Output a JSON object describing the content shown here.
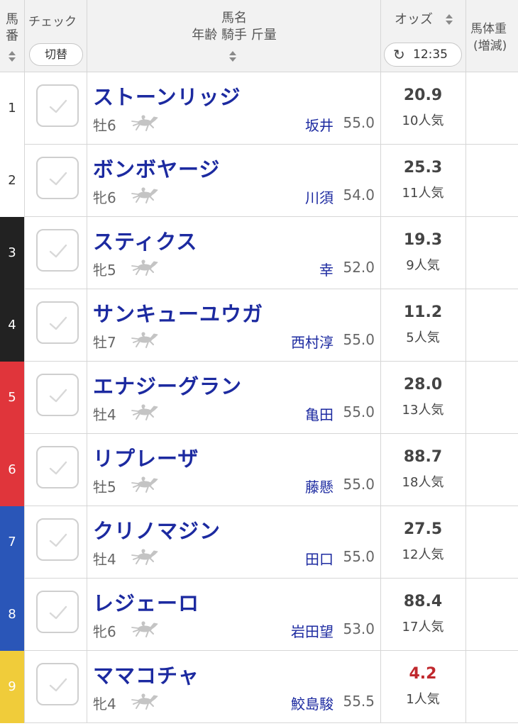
{
  "header": {
    "num_line1": "馬",
    "num_line2": "番",
    "check_label": "チェック",
    "toggle_label": "切替",
    "name_label": "馬名",
    "sub_label": "年齢 騎手 斤量",
    "odds_label": "オッズ",
    "refresh_icon": "refresh-icon",
    "refresh_time": "12:35",
    "weight_line1": "馬体重",
    "weight_line2": "(増減)"
  },
  "colors": {
    "name_blue": "#1c2aa0",
    "favorite_red": "#c0282d"
  },
  "horses": [
    {
      "num": "1",
      "name": "ストーンリッジ",
      "sex_age": "牡6",
      "jockey": "坂井",
      "weight": "55.0",
      "odds": "20.9",
      "popularity": "10人気",
      "frame_color": "#ffffff",
      "num_color": "#333333",
      "favorite": false
    },
    {
      "num": "2",
      "name": "ボンボヤージ",
      "sex_age": "牝6",
      "jockey": "川須",
      "weight": "54.0",
      "odds": "25.3",
      "popularity": "11人気",
      "frame_color": "#ffffff",
      "num_color": "#333333",
      "favorite": false
    },
    {
      "num": "3",
      "name": "スティクス",
      "sex_age": "牝5",
      "jockey": "幸",
      "weight": "52.0",
      "odds": "19.3",
      "popularity": "9人気",
      "frame_color": "#222222",
      "num_color": "#ffffff",
      "favorite": false
    },
    {
      "num": "4",
      "name": "サンキューユウガ",
      "sex_age": "牡7",
      "jockey": "西村淳",
      "weight": "55.0",
      "odds": "11.2",
      "popularity": "5人気",
      "frame_color": "#222222",
      "num_color": "#ffffff",
      "favorite": false
    },
    {
      "num": "5",
      "name": "エナジーグラン",
      "sex_age": "牡4",
      "jockey": "亀田",
      "weight": "55.0",
      "odds": "28.0",
      "popularity": "13人気",
      "frame_color": "#e0353b",
      "num_color": "#ffffff",
      "favorite": false
    },
    {
      "num": "6",
      "name": "リプレーザ",
      "sex_age": "牡5",
      "jockey": "藤懸",
      "weight": "55.0",
      "odds": "88.7",
      "popularity": "18人気",
      "frame_color": "#e0353b",
      "num_color": "#ffffff",
      "favorite": false
    },
    {
      "num": "7",
      "name": "クリノマジン",
      "sex_age": "牡4",
      "jockey": "田口",
      "weight": "55.0",
      "odds": "27.5",
      "popularity": "12人気",
      "frame_color": "#2a56b8",
      "num_color": "#ffffff",
      "favorite": false
    },
    {
      "num": "8",
      "name": "レジェーロ",
      "sex_age": "牝6",
      "jockey": "岩田望",
      "weight": "53.0",
      "odds": "88.4",
      "popularity": "17人気",
      "frame_color": "#2a56b8",
      "num_color": "#ffffff",
      "favorite": false
    },
    {
      "num": "9",
      "name": "ママコチャ",
      "sex_age": "牝4",
      "jockey": "鮫島駿",
      "weight": "55.5",
      "odds": "4.2",
      "popularity": "1人気",
      "frame_color": "#f0cc3a",
      "num_color": "#ffffff",
      "favorite": true
    }
  ]
}
